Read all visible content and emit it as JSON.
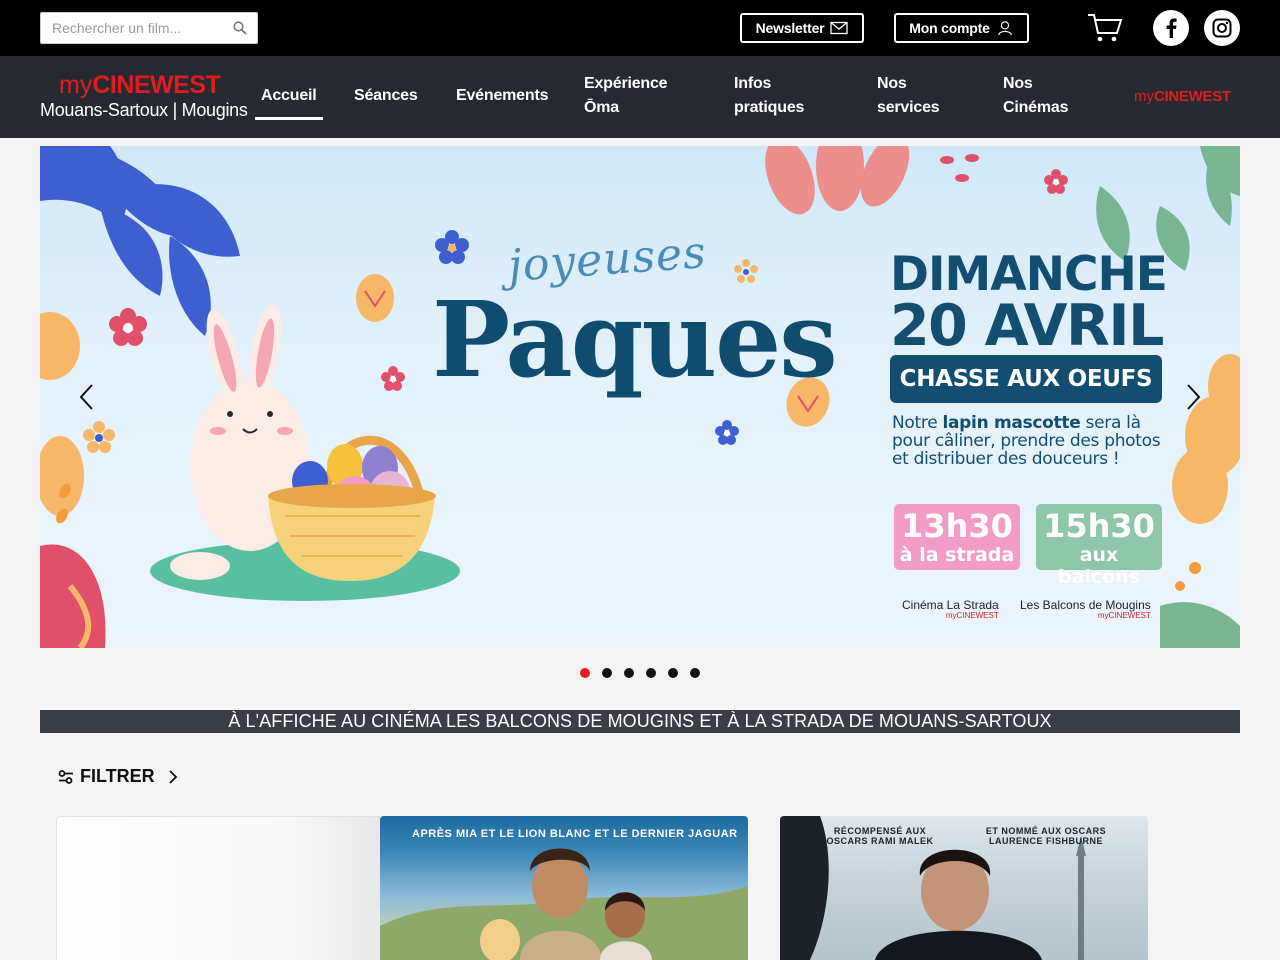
{
  "search": {
    "placeholder": "Rechercher un film..."
  },
  "topbar": {
    "newsletter_label": "Newsletter",
    "account_label": "Mon compte"
  },
  "logo": {
    "my": "my",
    "brand": "CINEWEST",
    "cities": "Mouans-Sartoux | Mougins"
  },
  "nav": {
    "items": [
      {
        "label": "Accueil"
      },
      {
        "label": "Séances"
      },
      {
        "label": "Evénements"
      },
      {
        "label": "Expérience Ōma"
      },
      {
        "label": "Infos pratiques"
      },
      {
        "label": "Nos services"
      },
      {
        "label": "Nos Cinémas"
      }
    ],
    "small_logo_my": "my",
    "small_logo_brand": "CINEWEST"
  },
  "banner": {
    "script_title": "joyeuses",
    "big_title": "Paques",
    "day": "DIMANCHE",
    "date": "20 AVRIL",
    "event": "CHASSE AUX OEUFS",
    "desc_pre": "Notre ",
    "desc_bold": "lapin mascotte",
    "desc_post": " sera là pour câliner, prendre des photos et distribuer des douceurs !",
    "time1": {
      "hour": "13h30",
      "place": "à la strada"
    },
    "time2": {
      "hour": "15h30",
      "place": "aux balcons"
    },
    "cinema1": {
      "name": "Cinéma La Strada",
      "brand": "myCINEWEST"
    },
    "cinema2": {
      "name": "Les Balcons de Mougins",
      "brand": "myCINEWEST"
    },
    "slide_count": 6,
    "active_slide": 1
  },
  "section": {
    "title": "À L'AFFICHE AU CINÉMA LES BALCONS DE MOUGINS ET À LA STRADA DE MOUANS-SARTOUX"
  },
  "filter": {
    "label": "FILTRER"
  },
  "posters": [
    {
      "tagline": "APRÈS MIA ET LE LION BLANC ET LE DERNIER JAGUAR"
    },
    {
      "tag_left": "RÉCOMPENSÉ AUX OSCARS RAMI MALEK",
      "tag_right": "ET NOMMÉ AUX OSCARS LAURENCE FISHBURNE"
    }
  ],
  "colors": {
    "brand_red": "#e21b22",
    "nav_bg": "#262a30",
    "banner_navy": "#134d70"
  }
}
